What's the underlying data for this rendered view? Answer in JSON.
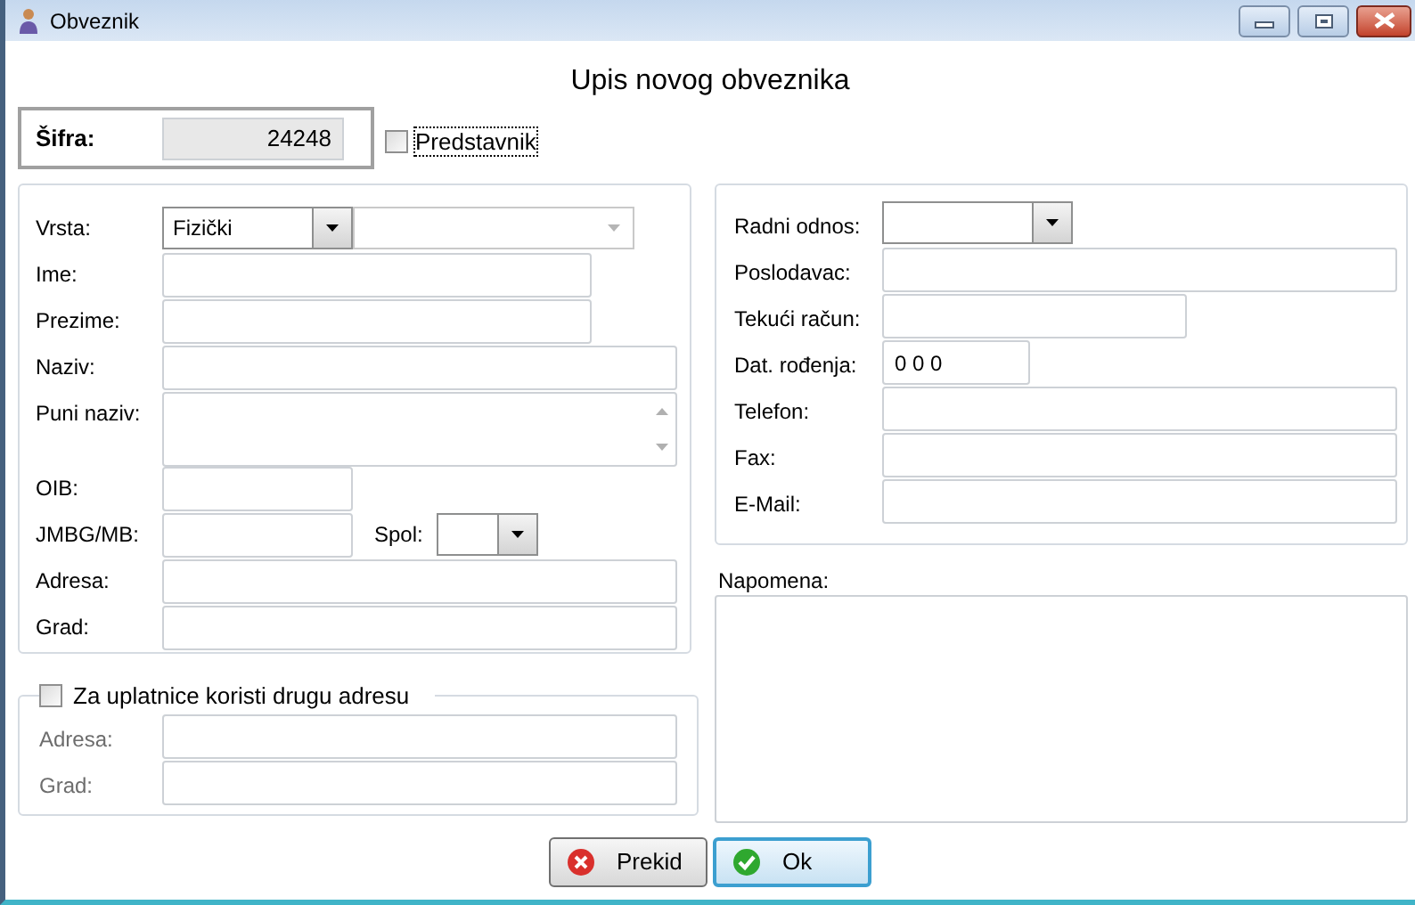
{
  "window": {
    "title": "Obveznik"
  },
  "heading": "Upis novog obveznika",
  "sifra": {
    "label": "Šifra:",
    "value": "24248"
  },
  "predstavnik": {
    "label": "Predstavnik",
    "checked": false
  },
  "person_fields": [
    {
      "label": "Vrsta:",
      "kind": "combo_pair",
      "value": "Fizički",
      "secondary_disabled": true
    },
    {
      "label": "Ime:",
      "kind": "text"
    },
    {
      "label": "Prezime:",
      "kind": "text"
    },
    {
      "label": "Naziv:",
      "kind": "text"
    },
    {
      "label": "Puni naziv:",
      "kind": "textarea"
    },
    {
      "label": "OIB:",
      "kind": "text"
    },
    {
      "label": "JMBG/MB:",
      "kind": "text_combo",
      "combo_label": "Spol:"
    },
    {
      "label": "Adresa:",
      "kind": "text"
    },
    {
      "label": "Grad:",
      "kind": "text"
    }
  ],
  "alt_address": {
    "label": "Za uplatnice koristi drugu adresu",
    "checked": false,
    "fields": [
      {
        "label": "Adresa:",
        "disabled": true
      },
      {
        "label": "Grad:",
        "disabled": true
      }
    ]
  },
  "work_fields": [
    {
      "label": "Radni odnos:",
      "kind": "combo"
    },
    {
      "label": "Poslodavac:",
      "kind": "text"
    },
    {
      "label": "Tekući račun:",
      "kind": "text"
    },
    {
      "label": "Dat. rođenja:",
      "kind": "text",
      "value": "0 0 0"
    },
    {
      "label": "Telefon:",
      "kind": "text"
    },
    {
      "label": "Fax:",
      "kind": "text"
    },
    {
      "label": "E-Mail:",
      "kind": "text"
    }
  ],
  "note": {
    "label": "Napomena:"
  },
  "buttons": [
    {
      "label": "Prekid",
      "kind": "cancel",
      "focused": false
    },
    {
      "label": "Ok",
      "kind": "ok",
      "focused": true
    }
  ]
}
